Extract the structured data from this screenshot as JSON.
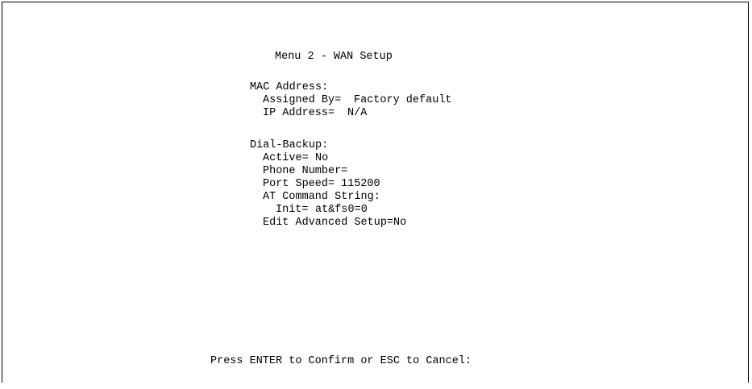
{
  "screen": {
    "title": "Menu 2 - WAN Setup",
    "mac_address": {
      "heading": "MAC Address:",
      "assigned_by_label": "Assigned By=",
      "assigned_by_value": "Factory default",
      "ip_address_label": "IP Address=",
      "ip_address_value": "N/A"
    },
    "dial_backup": {
      "heading": "Dial-Backup:",
      "active_label": "Active=",
      "active_value": "No",
      "phone_number_label": "Phone Number=",
      "phone_number_value": "",
      "port_speed_label": "Port Speed=",
      "port_speed_value": "115200",
      "at_command_heading": "AT Command String:",
      "init_label": "Init=",
      "init_value": "at&fs0=0",
      "edit_advanced_label": "Edit Advanced Setup=",
      "edit_advanced_value": "No"
    },
    "prompt": "Press ENTER to Confirm or ESC to Cancel:"
  }
}
